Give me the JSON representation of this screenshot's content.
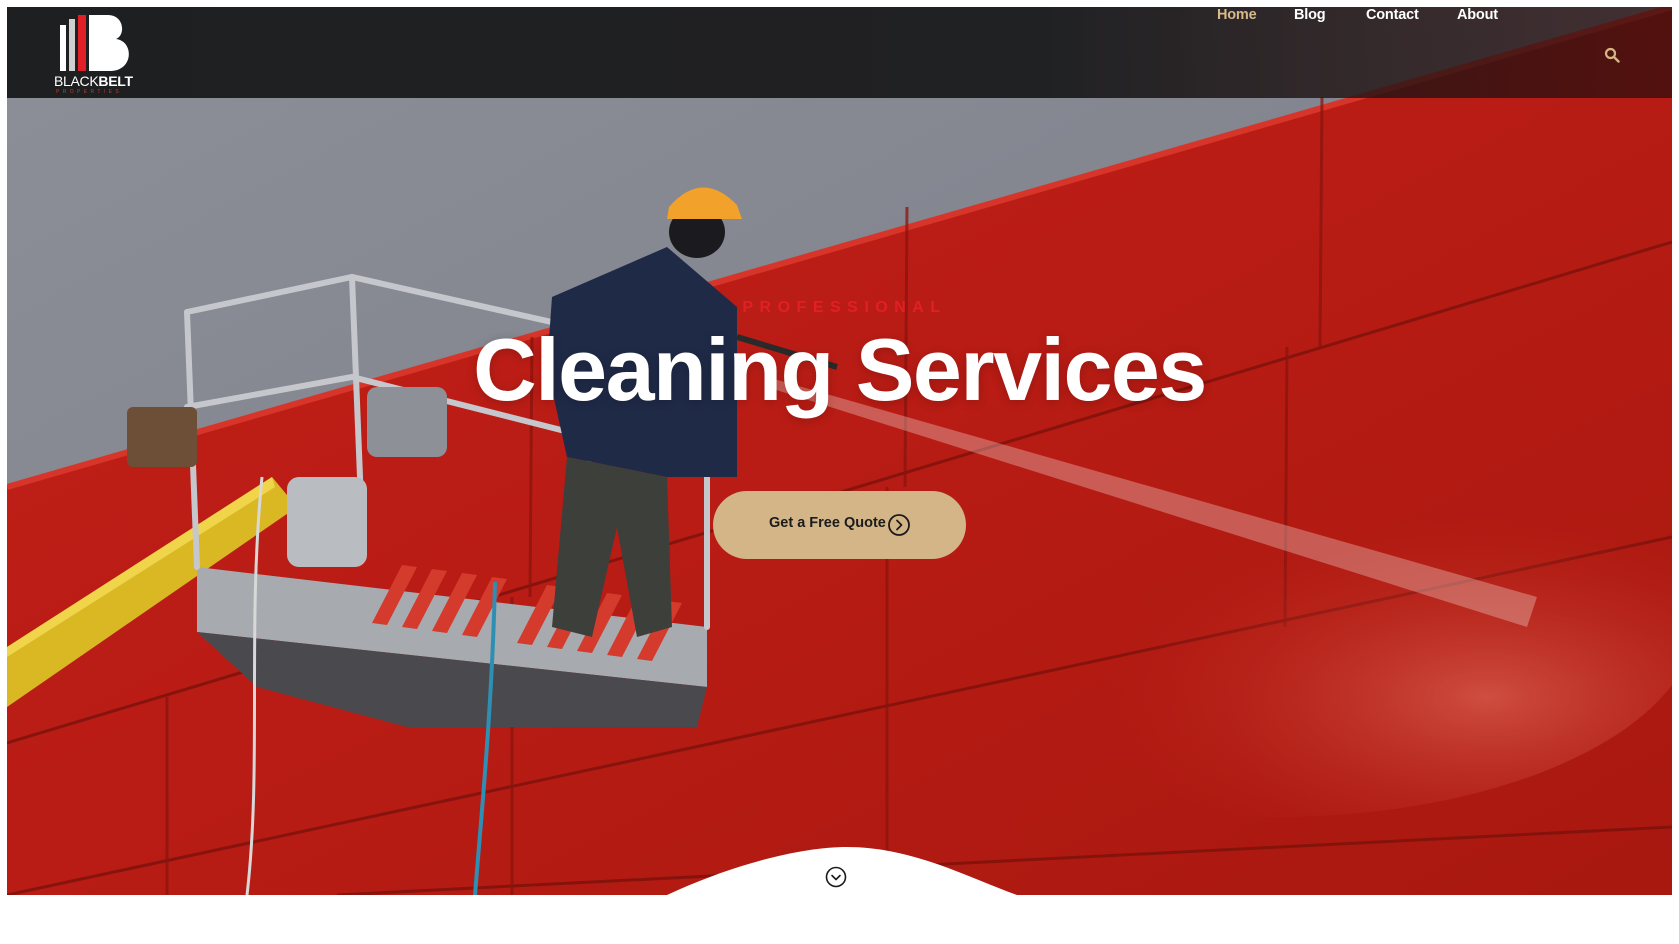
{
  "brand": {
    "name_light": "BLACK",
    "name_bold": "BELT",
    "tagline": "PROPERTIES",
    "colors": {
      "accent_red": "#e11f26",
      "gold": "#d4b587",
      "dark": "#1e1f21"
    }
  },
  "nav": {
    "items": [
      {
        "label": "Home",
        "active": true
      },
      {
        "label": "Blog",
        "active": false
      },
      {
        "label": "Contact",
        "active": false
      },
      {
        "label": "About",
        "active": false
      }
    ],
    "search_icon": "search-icon"
  },
  "hero": {
    "eyebrow": "PROFESSIONAL",
    "headline": "Cleaning Services",
    "cta_label": "Get a Free Quote",
    "cta_icon": "chevron-right-circle-icon",
    "scroll_icon": "chevron-down-circle-icon"
  }
}
